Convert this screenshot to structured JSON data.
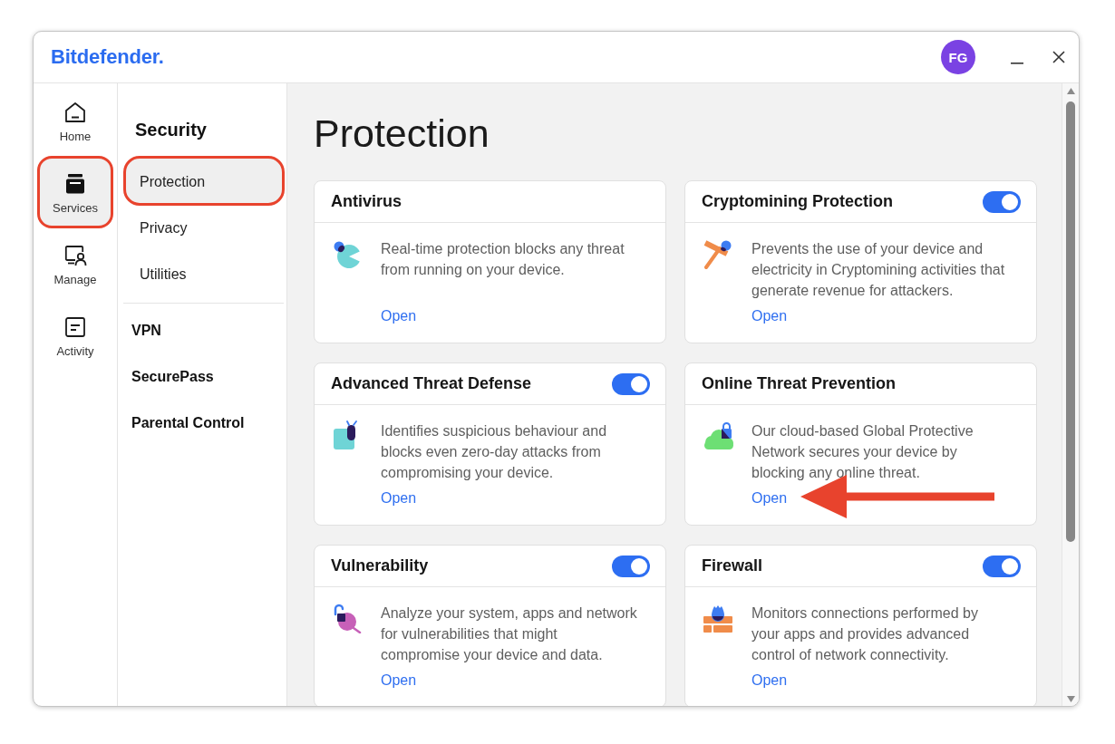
{
  "title_bar": {
    "logo": "Bitdefender.",
    "avatar": "FG"
  },
  "rail": [
    {
      "label": "Home",
      "selected": false,
      "annotated": false
    },
    {
      "label": "Services",
      "selected": true,
      "annotated": true
    },
    {
      "label": "Manage",
      "selected": false,
      "annotated": false
    },
    {
      "label": "Activity",
      "selected": false,
      "annotated": false
    }
  ],
  "section_nav": {
    "heading": "Security",
    "items": [
      {
        "label": "Protection",
        "selected": true,
        "annotated": true
      },
      {
        "label": "Privacy",
        "selected": false,
        "annotated": false
      },
      {
        "label": "Utilities",
        "selected": false,
        "annotated": false
      }
    ],
    "more": [
      {
        "label": "VPN",
        "selected": false
      },
      {
        "label": "SecurePass",
        "selected": false
      },
      {
        "label": "Parental Control",
        "selected": false
      }
    ]
  },
  "page": {
    "title": "Protection"
  },
  "cards": [
    {
      "title": "Antivirus",
      "description": "Real-time protection blocks any threat from running on your device.",
      "link": "Open",
      "annotated": false
    },
    {
      "title": "Cryptomining Protection",
      "toggle_on": true,
      "description": "Prevents the use of your device and electricity in Cryptomining activities that generate revenue for attackers.",
      "link": "Open",
      "annotated": false
    },
    {
      "title": "Advanced Threat Defense",
      "toggle_on": true,
      "description": "Identifies suspicious behaviour and blocks even zero-day attacks from compromising your device.",
      "link": "Open",
      "annotated": false
    },
    {
      "title": "Online Threat Prevention",
      "description": "Our cloud-based Global Protective Network secures your device by blocking any online threat.",
      "link": "Open",
      "annotated": true
    },
    {
      "title": "Vulnerability",
      "toggle_on": true,
      "description": "Analyze your system, apps and network for vulnerabilities that might compromise your device and data.",
      "link": "Open",
      "annotated": false
    },
    {
      "title": "Firewall",
      "toggle_on": true,
      "description": "Monitors connections performed by your apps and provides advanced control of network connectivity.",
      "link": "Open",
      "annotated": false
    }
  ]
}
